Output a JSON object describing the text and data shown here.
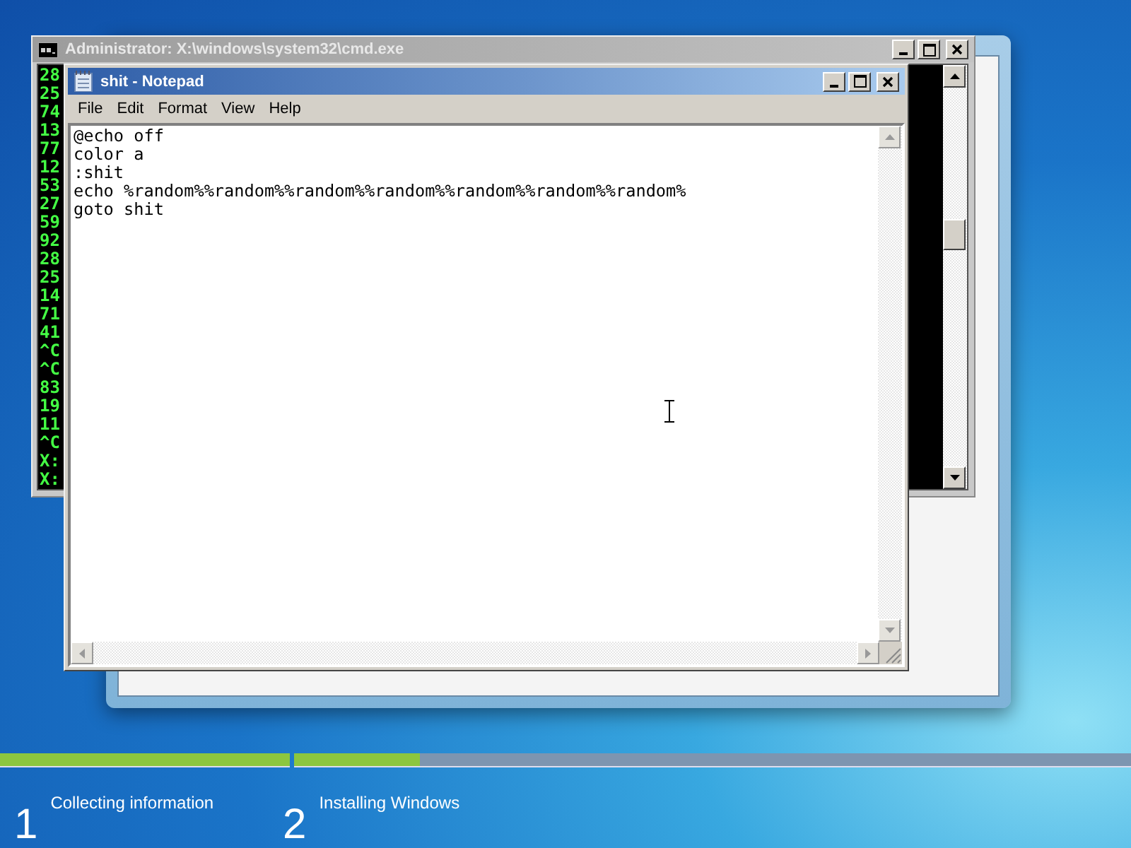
{
  "cmd_window": {
    "title": "Administrator: X:\\windows\\system32\\cmd.exe",
    "lines": [
      "28",
      "25",
      "74",
      "13",
      "77",
      "12",
      "53",
      "27",
      "59",
      "92",
      "28",
      "25",
      "14",
      "71",
      "41",
      "^C",
      "^C",
      "83",
      "19",
      "11",
      "^C",
      "X:",
      "X:"
    ]
  },
  "notepad": {
    "title": "shit - Notepad",
    "menu": [
      "File",
      "Edit",
      "Format",
      "View",
      "Help"
    ],
    "lines": [
      "@echo off",
      "color a",
      ":shit",
      "echo %random%%random%%random%%random%%random%%random%%random%",
      "goto shit"
    ]
  },
  "setup_progress": {
    "steps": [
      {
        "number": "1",
        "label": "Collecting information",
        "level": 1
      },
      {
        "number": "2",
        "label": "Installing Windows",
        "level": 0.15
      }
    ]
  }
}
